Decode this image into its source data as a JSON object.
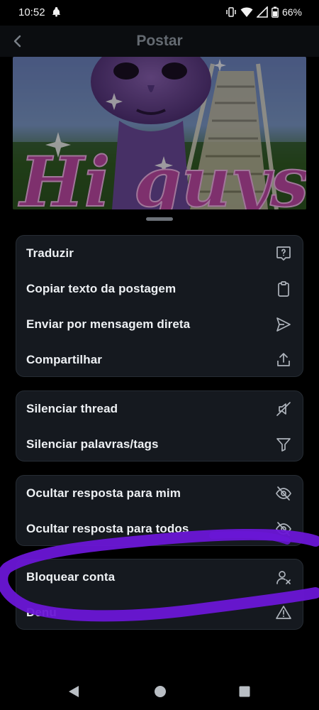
{
  "status_bar": {
    "time": "10:52",
    "battery": "66%",
    "icons": [
      "vibrate-icon",
      "wifi-icon",
      "signal-icon",
      "battery-icon"
    ]
  },
  "header": {
    "title": "Postar",
    "back_icon": "back-arrow-icon"
  },
  "post": {
    "image_caption_text": "Hi guys"
  },
  "menu_groups": [
    {
      "items": [
        {
          "label": "Traduzir",
          "icon": "translate-icon"
        },
        {
          "label": "Copiar texto da postagem",
          "icon": "clipboard-icon"
        },
        {
          "label": "Enviar por mensagem direta",
          "icon": "send-icon"
        },
        {
          "label": "Compartilhar",
          "icon": "share-icon"
        }
      ]
    },
    {
      "items": [
        {
          "label": "Silenciar thread",
          "icon": "mute-icon"
        },
        {
          "label": "Silenciar palavras/tags",
          "icon": "filter-icon"
        }
      ]
    },
    {
      "items": [
        {
          "label": "Ocultar resposta para mim",
          "icon": "eye-off-icon"
        },
        {
          "label": "Ocultar resposta para todos",
          "icon": "eye-off-icon"
        }
      ]
    },
    {
      "items": [
        {
          "label": "Bloquear conta",
          "icon": "block-user-icon"
        },
        {
          "label": "Denu",
          "icon": "warning-icon"
        }
      ]
    }
  ],
  "colors": {
    "background": "#000000",
    "card": "#15191f",
    "card_border": "#262c34",
    "text": "#eef1f4",
    "icon": "#aeb4bc",
    "header_title": "#646a71",
    "scribble": "#6a16d6"
  },
  "nav_bar": {
    "icons": [
      "back-triangle-icon",
      "home-circle-icon",
      "recents-square-icon"
    ]
  }
}
